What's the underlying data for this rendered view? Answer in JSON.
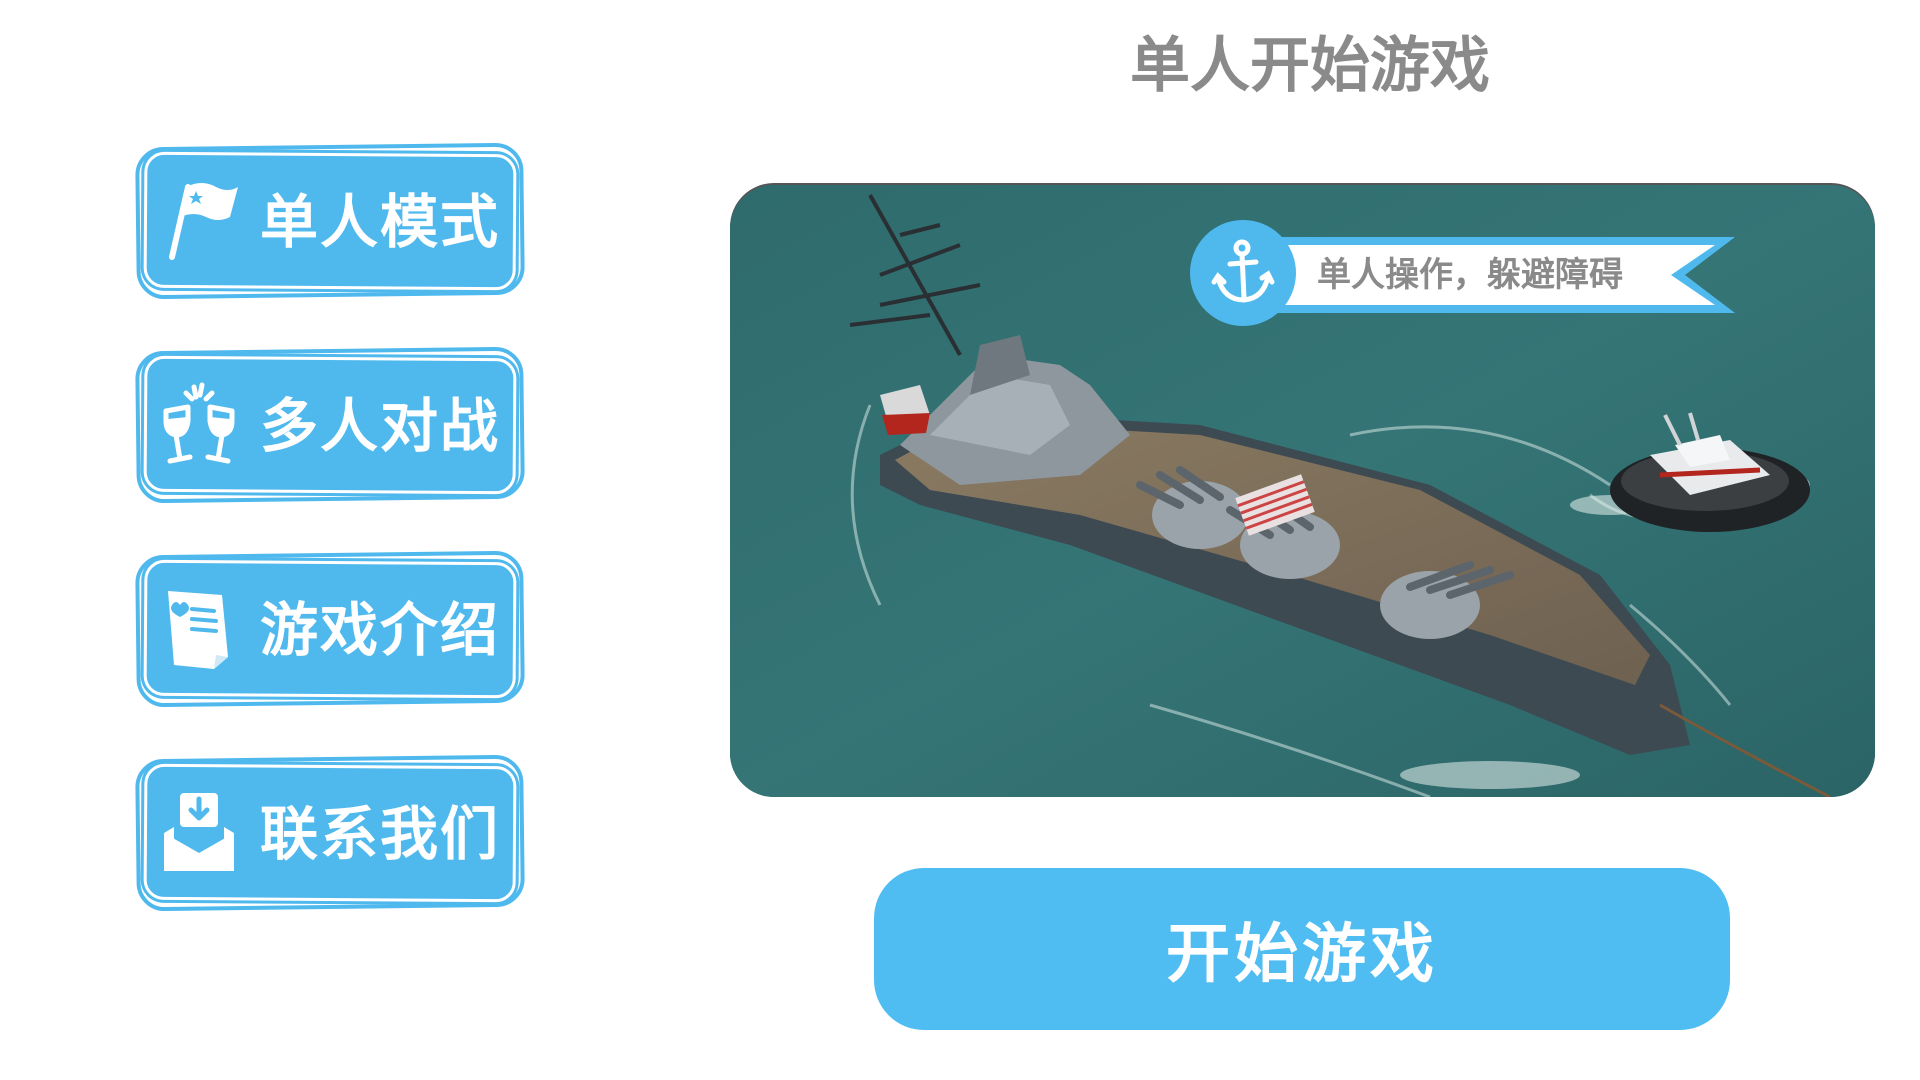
{
  "header": {
    "title": "单人开始游戏"
  },
  "sidebar": {
    "items": [
      {
        "label": "单人模式",
        "icon": "flag-icon"
      },
      {
        "label": "多人对战",
        "icon": "cheers-glasses-icon"
      },
      {
        "label": "游戏介绍",
        "icon": "document-icon"
      },
      {
        "label": "联系我们",
        "icon": "download-mail-icon"
      }
    ]
  },
  "preview": {
    "badge_icon": "anchor-icon",
    "ribbon_text": "单人操作，躲避障碍",
    "image": "battleship-with-tugboat"
  },
  "actions": {
    "start_label": "开始游戏"
  },
  "colors": {
    "accent": "#4fb9ee",
    "title_gray": "#8a8a8a",
    "sea": "#2f6e70",
    "background": "#ffffff"
  }
}
